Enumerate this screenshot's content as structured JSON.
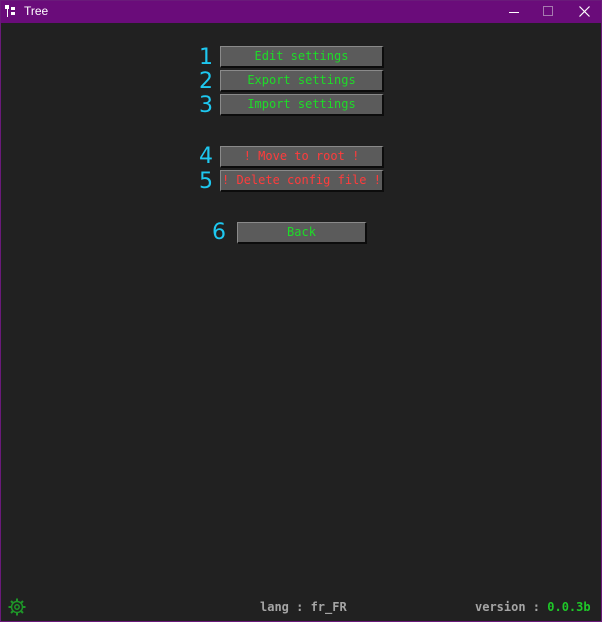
{
  "window": {
    "title": "Tree"
  },
  "menu": {
    "items": [
      {
        "number": "1",
        "label": "Edit settings",
        "style": "normal"
      },
      {
        "number": "2",
        "label": "Export settings",
        "style": "normal"
      },
      {
        "number": "3",
        "label": "Import settings",
        "style": "normal"
      },
      {
        "number": "4",
        "label": "! Move to root !",
        "style": "danger"
      },
      {
        "number": "5",
        "label": "! Delete config file !",
        "style": "danger"
      },
      {
        "number": "6",
        "label": "Back",
        "style": "normal"
      }
    ]
  },
  "footer": {
    "lang_label": "lang : ",
    "lang_value": "fr_FR",
    "version_label": "version : ",
    "version_value": "0.0.3b"
  },
  "colors": {
    "titlebar": "#6a0c7a",
    "background": "#212121",
    "button": "#5b5b5b",
    "number": "#1ec8f0",
    "normal_label": "#1edc28",
    "danger_label": "#ff3c3c",
    "footer_text": "#a5a5a5",
    "version_value": "#1ec828"
  },
  "icons": {
    "app": "tree-icon",
    "footer": "gear-icon",
    "minimize": "minimize-icon",
    "maximize": "maximize-icon",
    "close": "close-icon"
  }
}
